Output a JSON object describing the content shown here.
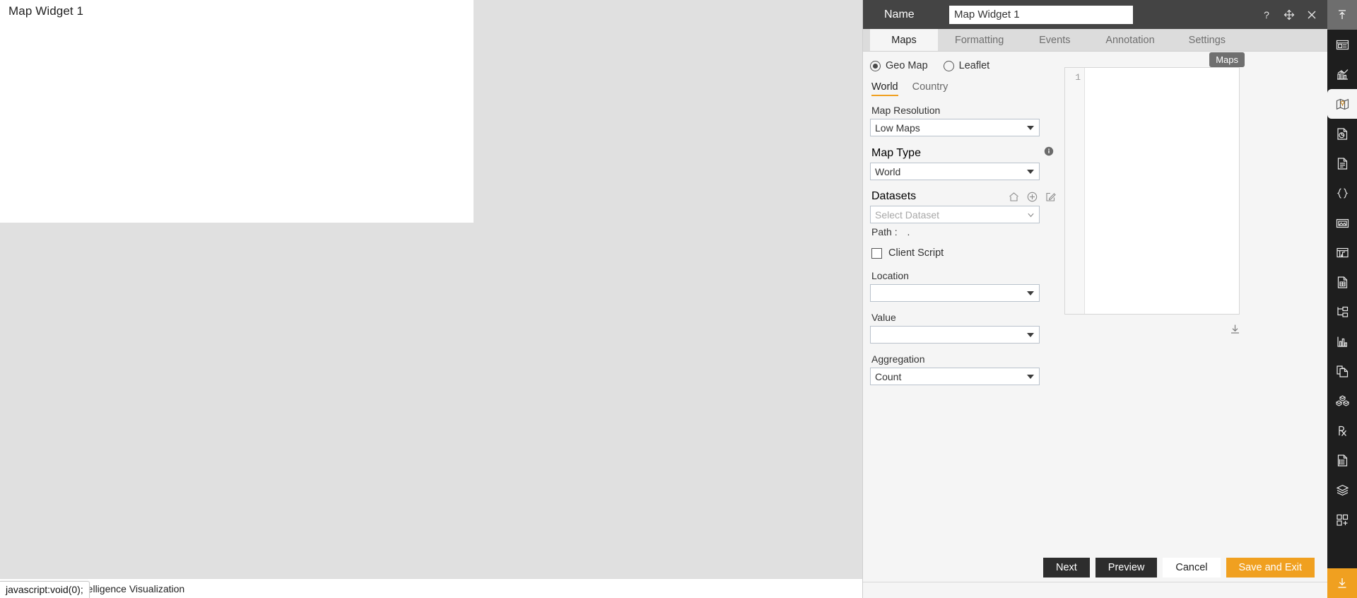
{
  "canvas": {
    "widget_title": "Map Widget 1"
  },
  "footer": {
    "text": "ntelligence Visualization",
    "status_tooltip": "javascript:void(0);"
  },
  "panel": {
    "titlebar": {
      "name_label": "Name",
      "name_value": "Map Widget 1",
      "icons": [
        {
          "name": "help-icon",
          "glyph": "?"
        },
        {
          "name": "move-icon",
          "glyph": "move"
        },
        {
          "name": "close-icon",
          "glyph": "x"
        }
      ]
    },
    "tabs": [
      {
        "label": "Maps",
        "active": true
      },
      {
        "label": "Formatting",
        "active": false
      },
      {
        "label": "Events",
        "active": false
      },
      {
        "label": "Annotation",
        "active": false
      },
      {
        "label": "Settings",
        "active": false
      }
    ],
    "map_engine": {
      "options": [
        {
          "label": "Geo Map",
          "selected": true
        },
        {
          "label": "Leaflet",
          "selected": false
        }
      ]
    },
    "scope_tabs": [
      {
        "label": "World",
        "active": true
      },
      {
        "label": "Country",
        "active": false
      }
    ],
    "fields": {
      "map_resolution_label": "Map Resolution",
      "map_resolution_value": "Low Maps",
      "map_type_label": "Map Type",
      "map_type_value": "World",
      "map_type_info_icon": "info-icon",
      "datasets_label": "Datasets",
      "datasets_placeholder": "Select Dataset",
      "dataset_icons": [
        "home-icon",
        "add-circle-icon",
        "edit-icon"
      ],
      "path_label": "Path :",
      "path_value": ".",
      "client_script_label": "Client Script",
      "client_script_checked": false,
      "location_label": "Location",
      "location_value": "",
      "value_label": "Value",
      "value_value": "",
      "aggregation_label": "Aggregation",
      "aggregation_value": "Count"
    },
    "preview": {
      "badge": "Maps",
      "line_number": "1",
      "download_icon": "download-icon"
    },
    "buttons": [
      {
        "label": "Next",
        "style": "dark",
        "name": "next-button"
      },
      {
        "label": "Preview",
        "style": "dark",
        "name": "preview-button"
      },
      {
        "label": "Cancel",
        "style": "light",
        "name": "cancel-button"
      },
      {
        "label": "Save and Exit",
        "style": "accent",
        "name": "save-and-exit-button"
      }
    ]
  },
  "rail": {
    "items": [
      {
        "name": "collapse-panel-icon",
        "state": "top"
      },
      {
        "name": "widget-card-icon",
        "state": "normal"
      },
      {
        "name": "chart-icon",
        "state": "normal"
      },
      {
        "name": "map-icon",
        "state": "active"
      },
      {
        "name": "report-pie-icon",
        "state": "normal"
      },
      {
        "name": "document-icon",
        "state": "normal"
      },
      {
        "name": "code-braces-icon",
        "state": "normal"
      },
      {
        "name": "image-gallery-icon",
        "state": "normal"
      },
      {
        "name": "media-frame-icon",
        "state": "normal"
      },
      {
        "name": "spreadsheet-icon",
        "state": "normal"
      },
      {
        "name": "tree-structure-icon",
        "state": "normal"
      },
      {
        "name": "bar-chart-icon",
        "state": "normal"
      },
      {
        "name": "copy-page-icon",
        "state": "normal"
      },
      {
        "name": "cubes-icon",
        "state": "normal"
      },
      {
        "name": "prescription-icon",
        "state": "normal"
      },
      {
        "name": "notes-icon",
        "state": "normal"
      },
      {
        "name": "layers-icon",
        "state": "normal"
      },
      {
        "name": "add-widget-icon",
        "state": "normal"
      },
      {
        "name": "download-rail-icon",
        "state": "accent"
      }
    ]
  },
  "colors": {
    "accent": "#f0a020",
    "titlebar": "#444444",
    "rail_bg": "#1e1e1e",
    "panel_bg": "#f5f5f5"
  }
}
